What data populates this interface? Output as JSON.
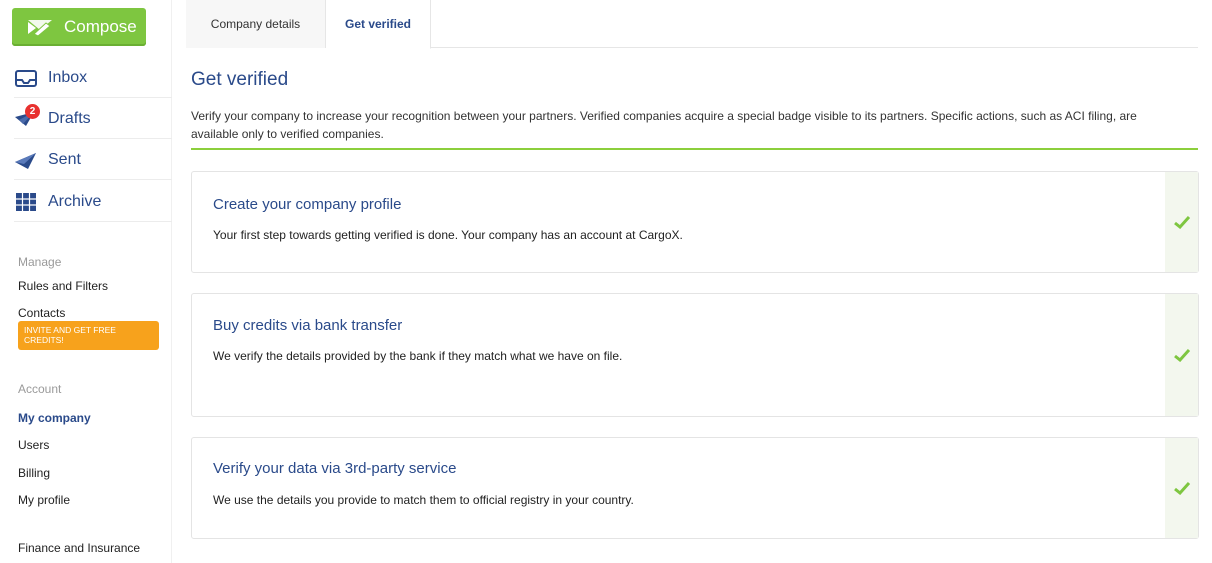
{
  "sidebar": {
    "compose_label": "Compose",
    "nav": [
      {
        "label": "Inbox",
        "icon": "inbox-icon"
      },
      {
        "label": "Drafts",
        "icon": "drafts-icon",
        "badge": "2"
      },
      {
        "label": "Sent",
        "icon": "sent-icon"
      },
      {
        "label": "Archive",
        "icon": "archive-icon"
      }
    ],
    "manage_label": "Manage",
    "rules_label": "Rules and Filters",
    "contacts_label": "Contacts",
    "invite_label": "INVITE AND GET FREE CREDITS!",
    "account_label": "Account",
    "my_company_label": "My company",
    "users_label": "Users",
    "billing_label": "Billing",
    "my_profile_label": "My profile",
    "finance_label": "Finance and Insurance"
  },
  "tabs": {
    "company_details": "Company details",
    "get_verified": "Get verified"
  },
  "page": {
    "title": "Get verified",
    "description": "Verify your company to increase your recognition between your partners. Verified companies acquire a special badge visible to its partners. Specific actions, such as ACI filing, are available only to verified companies."
  },
  "steps": [
    {
      "title": "Create your company profile",
      "description": "Your first step towards getting verified is done. Your company has an account at CargoX.",
      "status": "complete"
    },
    {
      "title": "Buy credits via bank transfer",
      "description": "We verify the details provided by the bank if they match what we have on file.",
      "status": "complete"
    },
    {
      "title": "Verify your data via 3rd-party service",
      "description": "We use the details you provide to match them to official registry in your country.",
      "status": "complete"
    }
  ],
  "colors": {
    "accent_blue": "#2a4a8a",
    "compose_green": "#7ec640",
    "check_green": "#7ec640",
    "invite_orange": "#f7a21c",
    "badge_red": "#e8312f"
  }
}
